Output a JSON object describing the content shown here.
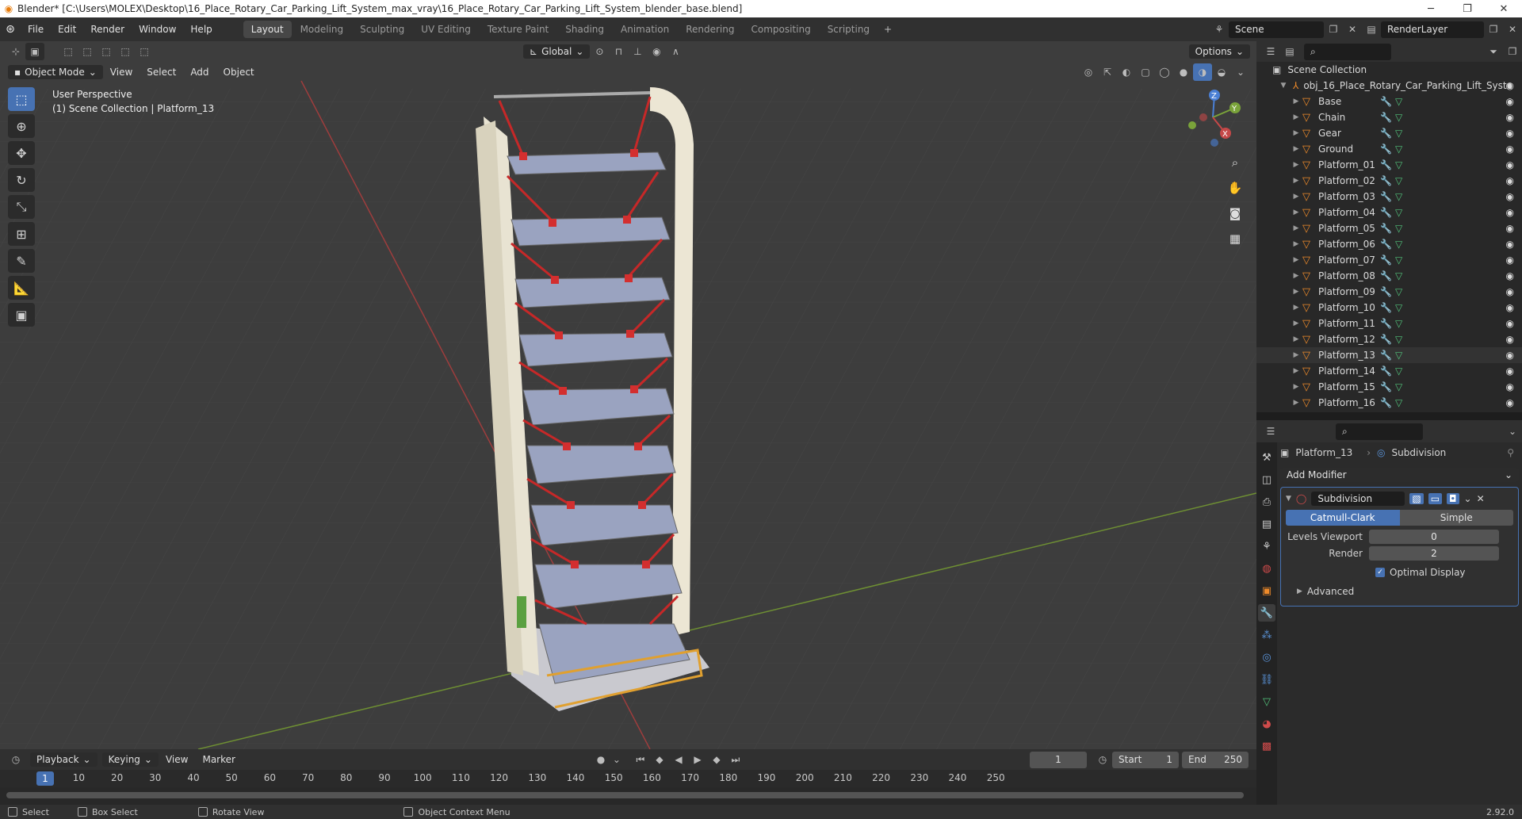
{
  "window": {
    "title": "Blender* [C:\\Users\\MOLEX\\Desktop\\16_Place_Rotary_Car_Parking_Lift_System_max_vray\\16_Place_Rotary_Car_Parking_Lift_System_blender_base.blend]"
  },
  "menus": [
    "File",
    "Edit",
    "Render",
    "Window",
    "Help"
  ],
  "workspaces": [
    "Layout",
    "Modeling",
    "Sculpting",
    "UV Editing",
    "Texture Paint",
    "Shading",
    "Animation",
    "Rendering",
    "Compositing",
    "Scripting"
  ],
  "scene": {
    "name": "Scene",
    "layer": "RenderLayer"
  },
  "viewport": {
    "mode": "Object Mode",
    "menu": [
      "View",
      "Select",
      "Add",
      "Object"
    ],
    "transform": "Global",
    "options": "Options",
    "overlay_line1": "User Perspective",
    "overlay_line2": "(1) Scene Collection | Platform_13"
  },
  "outliner": {
    "root": "Scene Collection",
    "collection": "obj_16_Place_Rotary_Car_Parking_Lift_Syste",
    "items": [
      "Base",
      "Chain",
      "Gear",
      "Ground",
      "Platform_01",
      "Platform_02",
      "Platform_03",
      "Platform_04",
      "Platform_05",
      "Platform_06",
      "Platform_07",
      "Platform_08",
      "Platform_09",
      "Platform_10",
      "Platform_11",
      "Platform_12",
      "Platform_13",
      "Platform_14",
      "Platform_15",
      "Platform_16"
    ],
    "selected": "Platform_13"
  },
  "properties": {
    "object": "Platform_13",
    "modifier_name": "Subdivision",
    "add_modifier": "Add Modifier",
    "mod_field": "Subdivision",
    "methods": [
      "Catmull-Clark",
      "Simple"
    ],
    "levels_viewport_label": "Levels Viewport",
    "levels_viewport": "0",
    "render_label": "Render",
    "render": "2",
    "optimal_display": "Optimal Display",
    "advanced": "Advanced"
  },
  "timeline": {
    "menu": [
      "Playback",
      "Keying",
      "View",
      "Marker"
    ],
    "current_frame": "1",
    "start_label": "Start",
    "start": "1",
    "end_label": "End",
    "end": "250",
    "ticks": [
      "10",
      "20",
      "30",
      "40",
      "50",
      "60",
      "70",
      "80",
      "90",
      "100",
      "110",
      "120",
      "130",
      "140",
      "150",
      "160",
      "170",
      "180",
      "190",
      "200",
      "210",
      "220",
      "230",
      "240",
      "250"
    ],
    "playhead": "1"
  },
  "status": {
    "select": "Select",
    "box": "Box Select",
    "rotate": "Rotate View",
    "ctx": "Object Context Menu",
    "version": "2.92.0"
  },
  "colors": {
    "accent": "#4772b3",
    "object": "#ee8a2a",
    "xaxis": "#b34a4a",
    "yaxis": "#7aa33a"
  }
}
